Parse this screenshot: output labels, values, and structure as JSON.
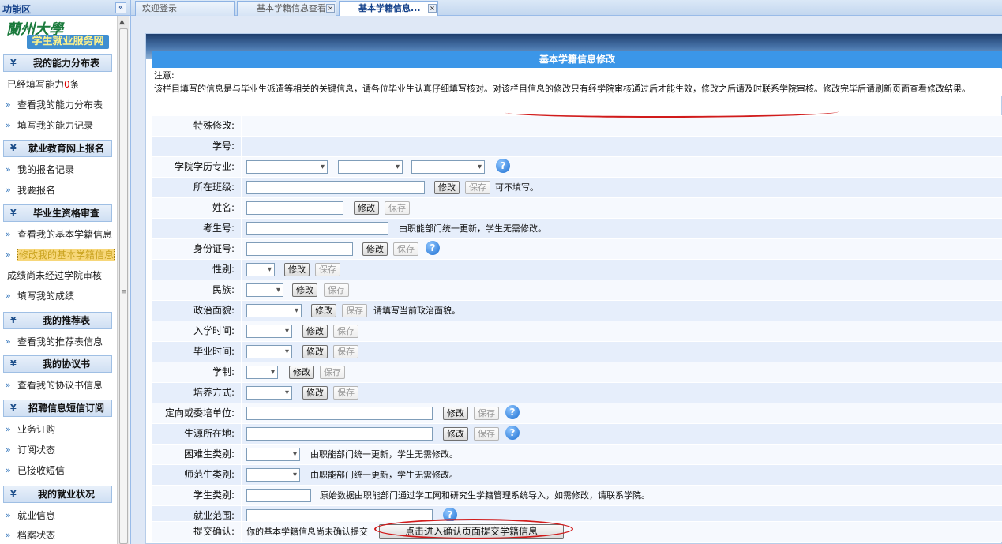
{
  "sidebar": {
    "title": "功能区",
    "collapse_icon": "«",
    "logo": {
      "name_cn": "蘭州大學",
      "subtitle": "学生就业服务网"
    },
    "sections": [
      {
        "label": "我的能力分布表"
      },
      {
        "label": "就业教育网上报名"
      },
      {
        "label": "毕业生资格审查"
      },
      {
        "label": "我的推荐表"
      },
      {
        "label": "我的协议书"
      },
      {
        "label": "招聘信息短信订阅"
      },
      {
        "label": "我的就业状况"
      }
    ],
    "ability_count": {
      "prefix": "已经填写能力",
      "count": "0",
      "suffix": "条"
    },
    "items": {
      "view_ability": "查看我的能力分布表",
      "fill_ability": "填写我的能力记录",
      "my_enroll": "我的报名记录",
      "enroll": "我要报名",
      "view_basic": "查看我的基本学籍信息",
      "edit_basic": "修改我的基本学籍信息",
      "grade_unreviewed": "成绩尚未经过学院审核",
      "fill_grade": "填写我的成绩",
      "view_recommend": "查看我的推荐表信息",
      "view_agreement": "查看我的协议书信息",
      "sub_order": "业务订购",
      "sub_status": "订阅状态",
      "received_sms": "已接收短信",
      "employment_info": "就业信息",
      "archive_status": "档案状态"
    }
  },
  "tabs": [
    {
      "label": "欢迎登录"
    },
    {
      "label": "基本学籍信息查看"
    },
    {
      "label": "基本学籍信息..."
    }
  ],
  "form": {
    "title": "基本学籍信息修改",
    "notice_label": "注意:",
    "notice_text": "该栏目填写的信息是与毕业生派遣等相关的关键信息，请各位毕业生认真仔细填写核对。对该栏目信息的修改只有经学院审核通过后才能生效，修改之后请及时联系学院审核。修改完毕后请刷新页面查看修改结果。",
    "buttons": {
      "edit": "修改",
      "save": "保存"
    },
    "labels": {
      "special": "特殊修改:",
      "student_no": "学号:",
      "college_major": "学院学历专业:",
      "class": "所在班级:",
      "name": "姓名:",
      "exam_no": "考生号:",
      "id_no": "身份证号:",
      "gender": "性别:",
      "ethnicity": "民族:",
      "politics": "政治面貌:",
      "enroll_time": "入学时间:",
      "grad_time": "毕业时间:",
      "duration": "学制:",
      "training": "培养方式:",
      "directed_unit": "定向或委培单位:",
      "origin": "生源所在地:",
      "hardship": "困难生类别:",
      "normal_student": "师范生类别:",
      "student_type": "学生类别:",
      "employment_scope": "就业范围:",
      "submit": "提交确认:"
    },
    "notes": {
      "class_optional": "可不填写。",
      "unified_update": "由职能部门统一更新，学生无需修改。",
      "politics_hint": "请填写当前政治面貌。",
      "student_type_hint": "原始数据由职能部门通过学工网和研究生学籍管理系统导入，如需修改，请联系学院。"
    },
    "submit_status": "你的基本学籍信息尚未确认提交",
    "submit_button": "点击进入确认页面提交学籍信息"
  },
  "colors": {
    "form_title_bg": "#3b96e8",
    "row_bg": "#e6eefb",
    "annotation_red": "#d11b1b",
    "highlight": "#f7d77a"
  }
}
